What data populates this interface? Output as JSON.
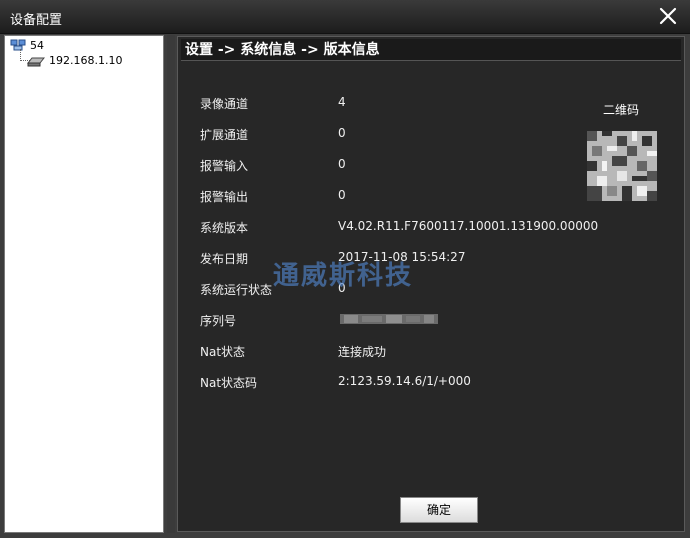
{
  "window": {
    "title": "设备配置"
  },
  "tree": {
    "root": {
      "label": "54"
    },
    "child": {
      "label": "192.168.1.10"
    }
  },
  "panel": {
    "breadcrumb": "设置 -> 系统信息 -> 版本信息",
    "qr_label": "二维码",
    "watermark": "通威斯科技",
    "rows": [
      {
        "key": "录像通道",
        "value": "4"
      },
      {
        "key": "扩展通道",
        "value": "0"
      },
      {
        "key": "报警输入",
        "value": "0"
      },
      {
        "key": "报警输出",
        "value": "0"
      },
      {
        "key": "系统版本",
        "value": "V4.02.R11.F7600117.10001.131900.00000"
      },
      {
        "key": "发布日期",
        "value": "2017-11-08 15:54:27"
      },
      {
        "key": "系统运行状态",
        "value": "0"
      },
      {
        "key": "序列号",
        "value": ""
      },
      {
        "key": "Nat状态",
        "value": "连接成功"
      },
      {
        "key": "Nat状态码",
        "value": "2:123.59.14.6/1/+000"
      }
    ],
    "ok_label": "确定"
  }
}
